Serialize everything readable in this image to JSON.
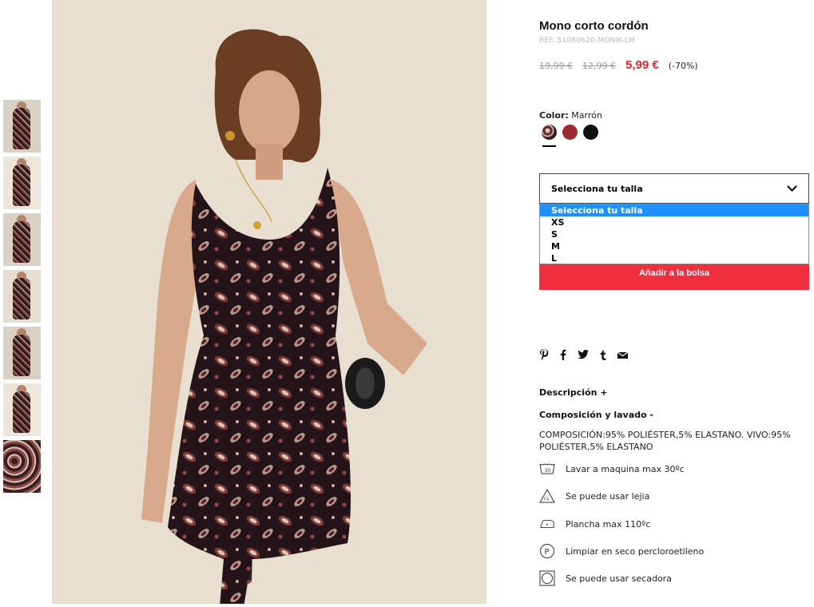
{
  "product": {
    "title": "Mono corto cordón",
    "ref": "REF. 51080620-MONIK-LM",
    "price_original": "19,99 €",
    "price_previous": "12,99 €",
    "price_current": "5,99 €",
    "discount": "(-70%)"
  },
  "color": {
    "label": "Color:",
    "selected": "Marrón",
    "swatches": [
      {
        "name": "Marrón",
        "hex": "#5a2b2e"
      },
      {
        "name": "Rojo",
        "hex": "#9c2a33"
      },
      {
        "name": "Negro",
        "hex": "#111111"
      }
    ]
  },
  "size": {
    "placeholder": "Selecciona tu talla",
    "options": [
      "Selecciona tu talla",
      "XS",
      "S",
      "M",
      "L"
    ],
    "highlighted_index": 0
  },
  "add_to_bag": "Añadir a la bolsa",
  "social": {
    "pinterest": "𝒫",
    "facebook": "f",
    "twitter": "🐦",
    "tumblr": "t",
    "email": "✉"
  },
  "sections": {
    "description": "Descripción +",
    "composition_title": "Composición y lavado -",
    "composition_text": "COMPOSICIÓN:95% POLIÉSTER,5% ELASTANO. VIVO:95% POLIÉSTER,5% ELASTANO"
  },
  "care": [
    {
      "icon": "wash-30-icon",
      "text": "Lavar a maquina max 30ºc"
    },
    {
      "icon": "bleach-icon",
      "text": "Se puede usar lejia"
    },
    {
      "icon": "iron-icon",
      "text": "Plancha max 110ºc"
    },
    {
      "icon": "dry-clean-p-icon",
      "text": "Limpiar en seco percloroetileno"
    },
    {
      "icon": "tumble-dry-icon",
      "text": "Se puede usar secadora"
    }
  ],
  "colors": {
    "price_red": "#e3242b",
    "button_red": "#f12e3d",
    "select_highlight": "#1e90ff"
  }
}
